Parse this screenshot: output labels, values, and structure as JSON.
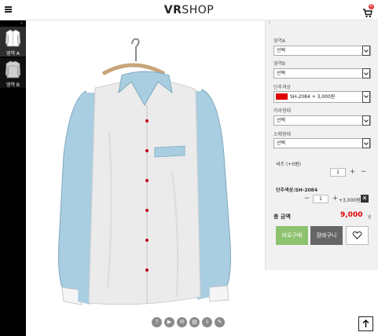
{
  "header": {
    "logo_bold": "VR",
    "logo_rest": "SHOP",
    "cart_count": "0"
  },
  "sidebar": {
    "collapse_glyph": "«",
    "items": [
      {
        "label": "영역 A",
        "icon": "shirt-front-icon",
        "active": true
      },
      {
        "label": "영역 B",
        "icon": "shirt-back-icon",
        "active": false
      }
    ]
  },
  "viewer": {
    "shirt_colors": {
      "body": "#ebebeb",
      "sleeves": "#a9cde1",
      "buttons": "#c0001a",
      "hanger": "#c8a57a"
    },
    "tools": [
      {
        "name": "help-icon",
        "glyph": "?"
      },
      {
        "name": "play-icon",
        "glyph": "▶"
      },
      {
        "name": "mail-icon",
        "glyph": "✉"
      },
      {
        "name": "save-icon",
        "glyph": "▤"
      },
      {
        "name": "download-icon",
        "glyph": "⇩"
      },
      {
        "name": "edit-icon",
        "glyph": "✎"
      }
    ]
  },
  "panel": {
    "collapse_glyph": "«",
    "options": [
      {
        "label": "영역A",
        "value": "선택"
      },
      {
        "label": "영역B",
        "value": "선택"
      },
      {
        "label": "단추색상",
        "value": "SH-2084  + 3,000원",
        "swatch": "#e00000"
      },
      {
        "label": "카라형태",
        "value": "선택"
      },
      {
        "label": "소매형태",
        "value": "선택"
      }
    ],
    "base_item": {
      "label": "셔츠 (+0원)",
      "qty": "1",
      "plus": "+",
      "minus": "−"
    },
    "added_item": {
      "label": "단추색상:SH-2084",
      "qty": "1",
      "minus": "−",
      "plus": "+",
      "price": "+3,000원",
      "remove": "✕"
    },
    "total": {
      "label": "총 금액",
      "price": "9,000",
      "unit": "원"
    },
    "buttons": {
      "buy": "바로구매",
      "cart": "장바구니"
    }
  },
  "colors": {
    "accent_green": "#8dc26f",
    "price_red": "#e00000",
    "sidebar_bg": "#000000"
  }
}
